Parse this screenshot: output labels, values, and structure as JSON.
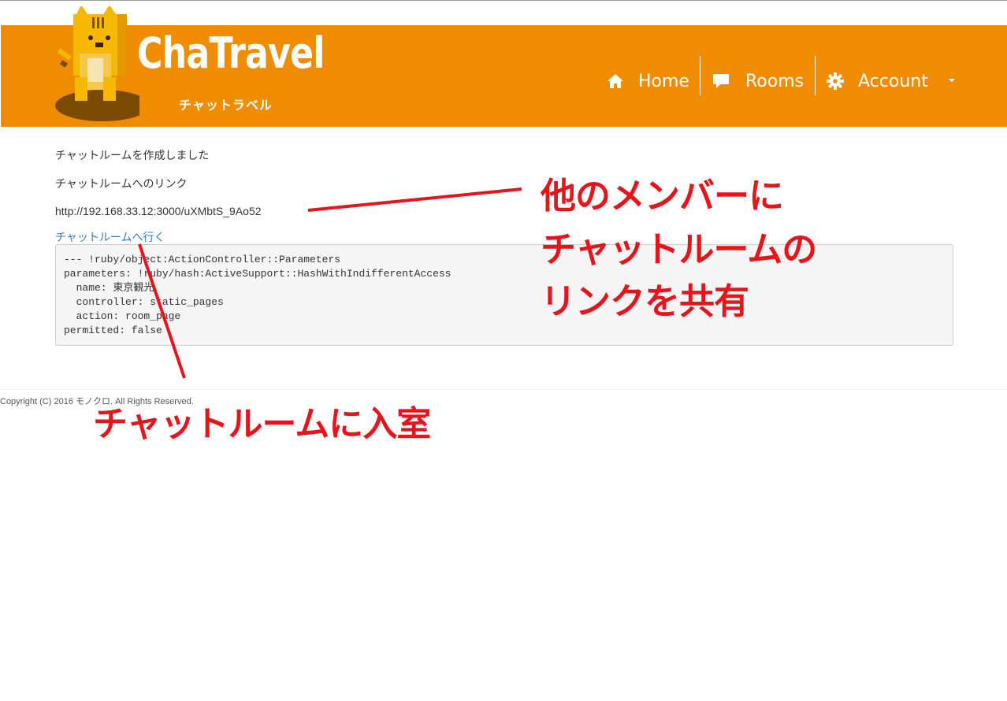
{
  "navbar": {
    "brand_title": "ChaTravel",
    "brand_subtitle": "チャットラベル",
    "items": [
      {
        "label": "Home",
        "icon": "home-icon"
      },
      {
        "label": "Rooms",
        "icon": "chat-bubble-icon"
      },
      {
        "label": "Account",
        "icon": "gear-icon"
      }
    ],
    "background_color": "#f08c00"
  },
  "main": {
    "message": "チャットルームを作成しました",
    "link_heading": "チャットルームへのリンク",
    "room_url": "http://192.168.33.12:3000/uXMbtS_9Ao52",
    "enter_link": "チャットルームへ行く",
    "debug_lines": [
      "--- !ruby/object:ActionController::Parameters",
      "parameters: !ruby/hash:ActiveSupport::HashWithIndifferentAccess",
      "  name: 東京観光",
      "  controller: static_pages",
      "  action: room_page",
      "permitted: false"
    ]
  },
  "footer": {
    "copyright": "Copyright (C) 2016 モノクロ. All Rights Reserved."
  },
  "annotations": {
    "share_lines": [
      "他のメンバーに",
      "チャットルームの",
      "リンクを共有"
    ],
    "enter_room": "チャットルームに入室",
    "color": "#e8141c"
  }
}
